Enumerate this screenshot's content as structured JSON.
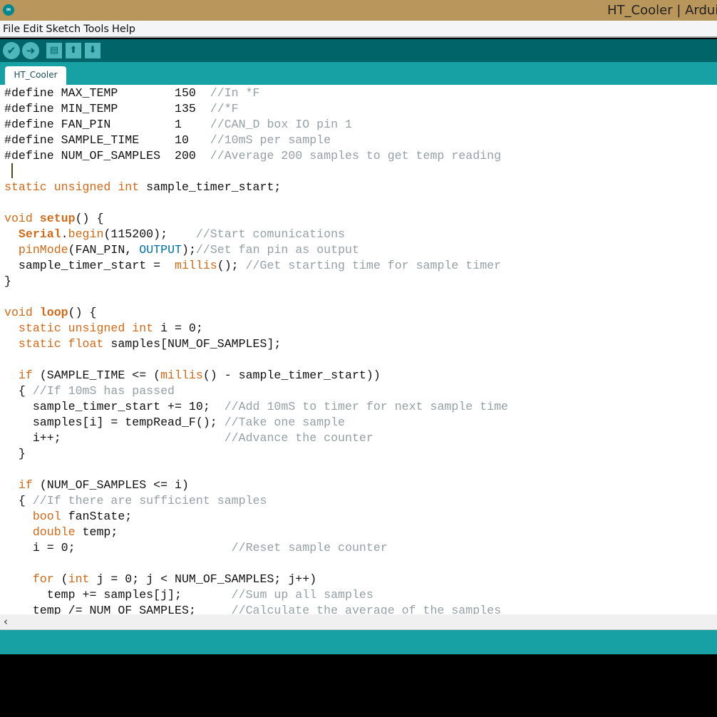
{
  "window": {
    "title": "HT_Cooler | Arduin",
    "icon": "arduino-logo-icon"
  },
  "menu": [
    "File",
    "Edit",
    "Sketch",
    "Tools",
    "Help"
  ],
  "toolbar": [
    {
      "name": "verify-button",
      "icon": "checkmark-icon",
      "glyph": "✔"
    },
    {
      "name": "upload-button",
      "icon": "arrow-right-icon",
      "glyph": "➜"
    },
    {
      "name": "new-button",
      "icon": "new-file-icon",
      "glyph": "▤"
    },
    {
      "name": "open-button",
      "icon": "arrow-up-icon",
      "glyph": "⬆"
    },
    {
      "name": "save-button",
      "icon": "arrow-down-icon",
      "glyph": "⬇"
    }
  ],
  "tabs": [
    {
      "label": "HT_Cooler"
    }
  ],
  "colors": {
    "keyword": "#cc6a1c",
    "comment": "#95a0a4",
    "constant": "#00709c",
    "toolbar": "#006468",
    "accent": "#17a1a5",
    "titlebar": "#b9965b"
  },
  "code": [
    [
      [
        "#define MAX_TEMP        150  ",
        "p"
      ],
      [
        "//In *F",
        "c"
      ]
    ],
    [
      [
        "#define MIN_TEMP        135  ",
        "p"
      ],
      [
        "//*F",
        "c"
      ]
    ],
    [
      [
        "#define FAN_PIN         1    ",
        "p"
      ],
      [
        "//CAN_D box IO pin 1",
        "c"
      ]
    ],
    [
      [
        "#define SAMPLE_TIME     10   ",
        "p"
      ],
      [
        "//10mS per sample",
        "c"
      ]
    ],
    [
      [
        "#define NUM_OF_SAMPLES  200  ",
        "p"
      ],
      [
        "//Average 200 samples to get temp reading",
        "c"
      ]
    ],
    [],
    [
      [
        "static unsigned int",
        "k"
      ],
      [
        " sample_timer_start;",
        "p"
      ]
    ],
    [],
    [
      [
        "void ",
        "k"
      ],
      [
        "setup",
        "b"
      ],
      [
        "() {",
        "p"
      ]
    ],
    [
      [
        "  ",
        "p"
      ],
      [
        "Serial",
        "b"
      ],
      [
        ".",
        "p"
      ],
      [
        "begin",
        "k"
      ],
      [
        "(115200);    ",
        "p"
      ],
      [
        "//Start comunications",
        "c"
      ]
    ],
    [
      [
        "  ",
        "p"
      ],
      [
        "pinMode",
        "k"
      ],
      [
        "(FAN_PIN, ",
        "p"
      ],
      [
        "OUTPUT",
        "o"
      ],
      [
        ");",
        "p"
      ],
      [
        "//Set fan pin as output",
        "c"
      ]
    ],
    [
      [
        "  sample_timer_start =  ",
        "p"
      ],
      [
        "millis",
        "k"
      ],
      [
        "(); ",
        "p"
      ],
      [
        "//Get starting time for sample timer",
        "c"
      ]
    ],
    [
      [
        "}",
        "p"
      ]
    ],
    [],
    [
      [
        "void ",
        "k"
      ],
      [
        "loop",
        "b"
      ],
      [
        "() {",
        "p"
      ]
    ],
    [
      [
        "  ",
        "p"
      ],
      [
        "static unsigned int",
        "k"
      ],
      [
        " i = 0;",
        "p"
      ]
    ],
    [
      [
        "  ",
        "p"
      ],
      [
        "static float",
        "k"
      ],
      [
        " samples[NUM_OF_SAMPLES];",
        "p"
      ]
    ],
    [],
    [
      [
        "  ",
        "p"
      ],
      [
        "if",
        "k"
      ],
      [
        " (SAMPLE_TIME <= (",
        "p"
      ],
      [
        "millis",
        "k"
      ],
      [
        "() - sample_timer_start))",
        "p"
      ]
    ],
    [
      [
        "  { ",
        "p"
      ],
      [
        "//If 10mS has passed",
        "c"
      ]
    ],
    [
      [
        "    sample_timer_start += 10;  ",
        "p"
      ],
      [
        "//Add 10mS to timer for next sample time",
        "c"
      ]
    ],
    [
      [
        "    samples[i] = tempRead_F(); ",
        "p"
      ],
      [
        "//Take one sample",
        "c"
      ]
    ],
    [
      [
        "    i++;                       ",
        "p"
      ],
      [
        "//Advance the counter",
        "c"
      ]
    ],
    [
      [
        "  }",
        "p"
      ]
    ],
    [],
    [
      [
        "  ",
        "p"
      ],
      [
        "if",
        "k"
      ],
      [
        " (NUM_OF_SAMPLES <= i)",
        "p"
      ]
    ],
    [
      [
        "  { ",
        "p"
      ],
      [
        "//If there are sufficient samples",
        "c"
      ]
    ],
    [
      [
        "    ",
        "p"
      ],
      [
        "bool",
        "k"
      ],
      [
        " fanState;",
        "p"
      ]
    ],
    [
      [
        "    ",
        "p"
      ],
      [
        "double",
        "k"
      ],
      [
        " temp;",
        "p"
      ]
    ],
    [
      [
        "    i = 0;                      ",
        "p"
      ],
      [
        "//Reset sample counter",
        "c"
      ]
    ],
    [],
    [
      [
        "    ",
        "p"
      ],
      [
        "for",
        "k"
      ],
      [
        " (",
        "p"
      ],
      [
        "int",
        "k"
      ],
      [
        " j = 0; j < NUM_OF_SAMPLES; j++)",
        "p"
      ]
    ],
    [
      [
        "      temp += samples[j];       ",
        "p"
      ],
      [
        "//Sum up all samples",
        "c"
      ]
    ],
    [
      [
        "    temp /= NUM_OF_SAMPLES;     ",
        "p"
      ],
      [
        "//Calculate the average of the samples",
        "c"
      ]
    ]
  ],
  "scrollbar": {
    "left_arrow": "‹"
  }
}
